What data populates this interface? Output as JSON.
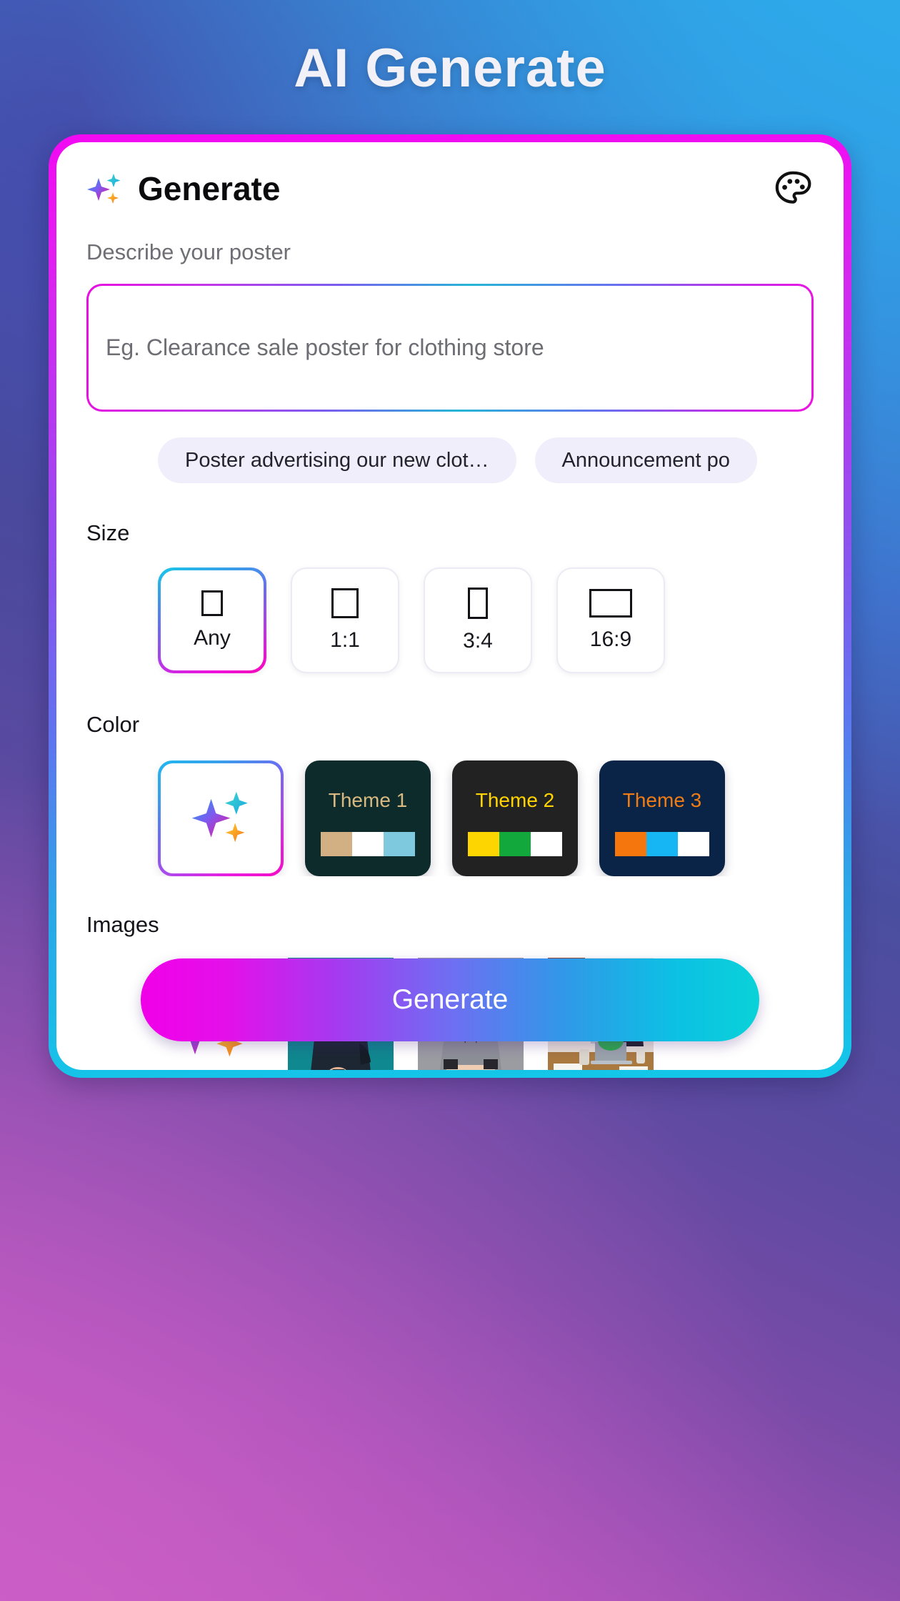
{
  "page": {
    "title": "AI Generate",
    "background_gradient_from": "#2fa8e8",
    "background_gradient_to": "#c55cc0"
  },
  "card": {
    "border_gradient_from": "#f209f2",
    "border_gradient_to": "#12c8e8",
    "header": {
      "title": "Generate",
      "sparkle_icon": "sparkles-icon",
      "palette_icon": "palette-icon"
    },
    "prompt": {
      "label": "Describe your poster",
      "placeholder": "Eg. Clearance sale poster for clothing store",
      "value": ""
    },
    "suggestions": [
      {
        "label": "Poster advertising our new clot…"
      },
      {
        "label": "Announcement po"
      }
    ],
    "size": {
      "label": "Size",
      "options": [
        {
          "name": "Any",
          "glyph": "g-any",
          "selected": true
        },
        {
          "name": "1:1",
          "glyph": "g-11",
          "selected": false
        },
        {
          "name": "3:4",
          "glyph": "g-34",
          "selected": false
        },
        {
          "name": "16:9",
          "glyph": "g-169",
          "selected": false
        }
      ]
    },
    "color": {
      "label": "Color",
      "options": [
        {
          "name": "AI",
          "type": "ai",
          "selected": true,
          "icon": "sparkles-icon"
        },
        {
          "name": "Theme 1",
          "type": "theme",
          "selected": false,
          "background": "#0d2b2b",
          "title_color": "#d8b982",
          "swatches": [
            "#d3b083",
            "#ffffff",
            "#7ec9dd"
          ]
        },
        {
          "name": "Theme 2",
          "type": "theme",
          "selected": false,
          "background": "#222222",
          "title_color": "#ffd400",
          "swatches": [
            "#fdd500",
            "#12a83c",
            "#ffffff"
          ]
        },
        {
          "name": "Theme 3",
          "type": "theme",
          "selected": false,
          "background": "#0a2447",
          "title_color": "#ef7c14",
          "swatches": [
            "#f4760d",
            "#16b6f4",
            "#ffffff"
          ]
        }
      ]
    },
    "images": {
      "label": "Images",
      "options": [
        {
          "alt": "ai-sparkles-option",
          "type": "ai",
          "selected": true
        },
        {
          "alt": "man-in-suit-teal-background",
          "type": "photo",
          "selected": false
        },
        {
          "alt": "woman-in-grey-suit",
          "type": "photo",
          "selected": false
        },
        {
          "alt": "two-colleagues-high-five-office",
          "type": "photo",
          "selected": false
        }
      ],
      "check_badge_color": "#4f2bdb"
    },
    "generate_button": {
      "label": "Generate",
      "gradient_from": "#f000e8",
      "gradient_to": "#0ad2d8"
    }
  }
}
